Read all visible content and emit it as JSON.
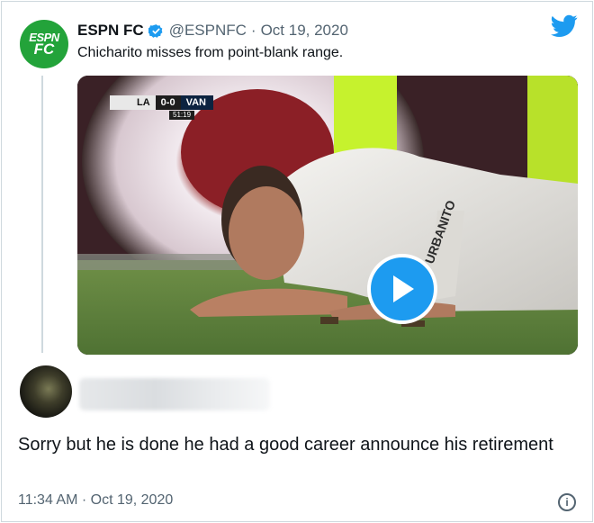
{
  "quoted_tweet": {
    "avatar_logo_line1": "ESPN",
    "avatar_logo_line2": "FC",
    "display_name": "ESPN FC",
    "handle": "@ESPNFC",
    "separator": "·",
    "date": "Oct 19, 2020",
    "text": "Chicharito misses from point-blank range.",
    "video": {
      "scoreboard": {
        "team_home": "LA",
        "score": "0-0",
        "team_away": "VAN",
        "clock": "51:19"
      }
    }
  },
  "reply": {
    "text": "Sorry but he is done he had a good career announce his retirement",
    "timestamp": "11:34 AM · Oct 19, 2020"
  },
  "icons": {
    "verified": "verified-badge-icon",
    "platform": "twitter-bird-icon",
    "play": "play-icon",
    "mute": "mute-icon",
    "info": "info-icon"
  },
  "colors": {
    "brand_blue": "#1d9bf0",
    "espn_green": "#23a33a",
    "secondary_text": "#536471"
  }
}
